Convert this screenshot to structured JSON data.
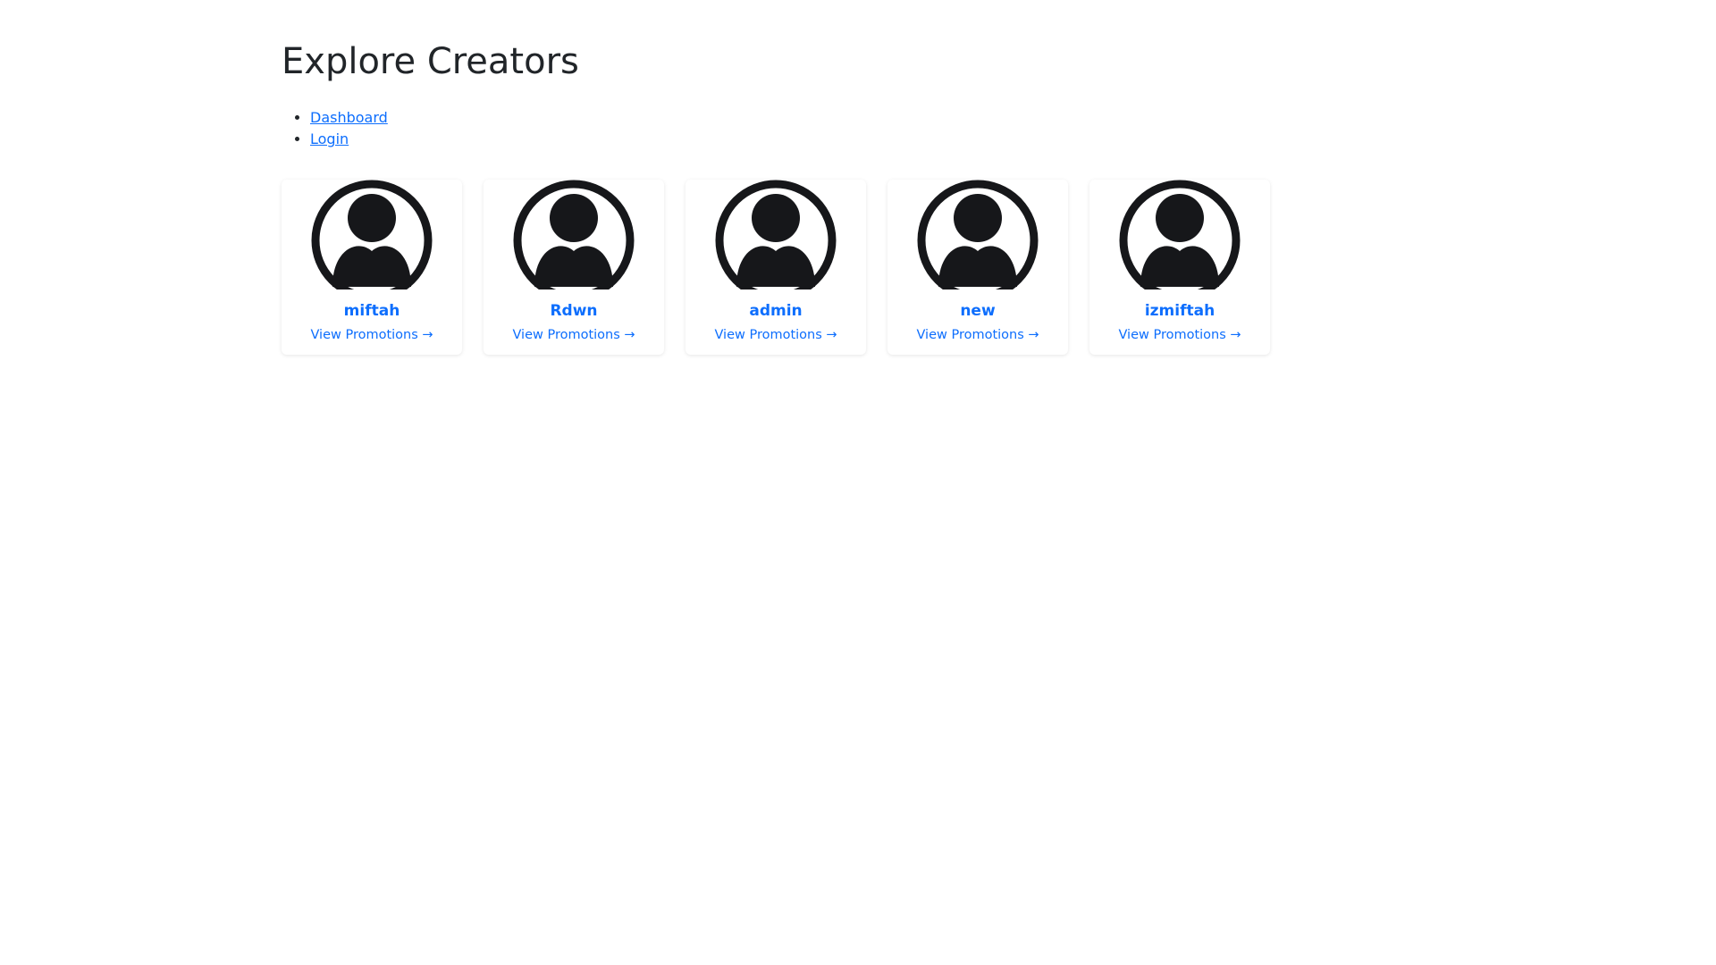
{
  "page": {
    "title": "Explore Creators"
  },
  "nav": {
    "items": [
      {
        "label": "Dashboard"
      },
      {
        "label": "Login"
      }
    ]
  },
  "creators": [
    {
      "name": "miftah",
      "link_label": "View Promotions →",
      "avatar_icon": "user-avatar-icon"
    },
    {
      "name": "Rdwn",
      "link_label": "View Promotions →",
      "avatar_icon": "user-avatar-icon"
    },
    {
      "name": "admin",
      "link_label": "View Promotions →",
      "avatar_icon": "user-avatar-icon"
    },
    {
      "name": "new",
      "link_label": "View Promotions →",
      "avatar_icon": "user-avatar-icon"
    },
    {
      "name": "izmiftah",
      "link_label": "View Promotions →",
      "avatar_icon": "user-avatar-icon"
    }
  ],
  "colors": {
    "link": "#0d6efd",
    "avatar": "#16171a"
  }
}
